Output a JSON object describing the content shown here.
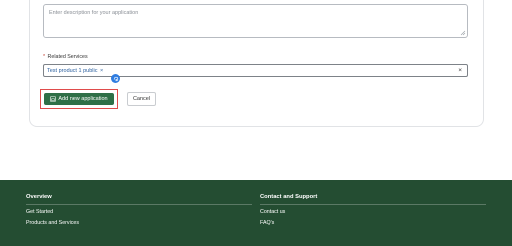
{
  "form": {
    "description": {
      "placeholder": "Enter description for your application",
      "value": ""
    },
    "related_services": {
      "required_mark": "*",
      "label": "Related Services",
      "tags": [
        {
          "label": "Test product 1 public",
          "remove": "×"
        }
      ],
      "clear_all": "×"
    },
    "actions": {
      "add_label": "Add new application",
      "cancel_label": "Cancel"
    }
  },
  "footer": {
    "overview": {
      "heading": "Overview",
      "links": [
        "Get Started",
        "Products and Services"
      ]
    },
    "contact": {
      "heading": "Contact and Support",
      "links": [
        "Contact us",
        "FAQ's"
      ]
    }
  },
  "colors": {
    "primary_button": "#2f6f47",
    "footer_background": "#244d32",
    "highlight_outline": "#e04b4b",
    "tag_text": "#2b5f9e",
    "badge": "#2f7de1"
  },
  "icons": {
    "add_button_icon": "window-add-icon",
    "badge_icon": "grammar-assistant-icon",
    "textarea_grip": "resize-grip-icon"
  }
}
